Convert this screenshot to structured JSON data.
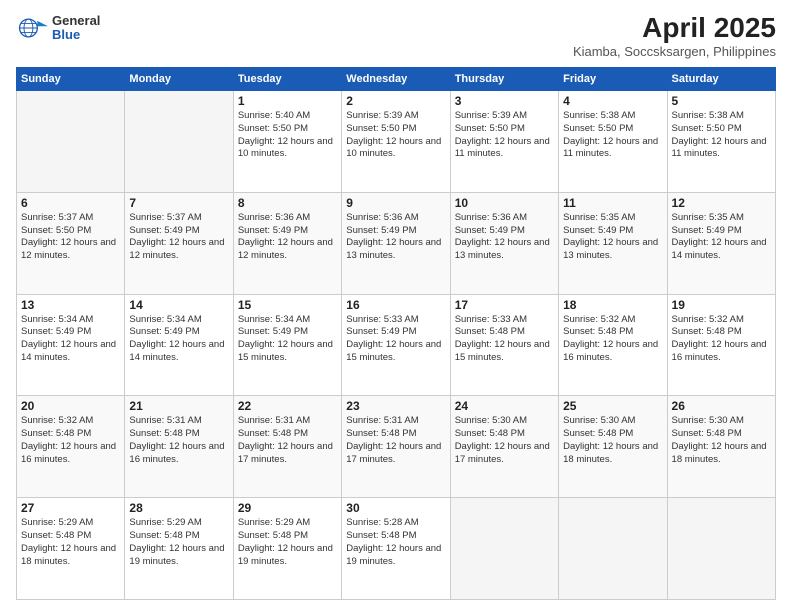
{
  "header": {
    "logo": {
      "general": "General",
      "blue": "Blue"
    },
    "title": "April 2025",
    "location": "Kiamba, Soccsksargen, Philippines"
  },
  "days_of_week": [
    "Sunday",
    "Monday",
    "Tuesday",
    "Wednesday",
    "Thursday",
    "Friday",
    "Saturday"
  ],
  "weeks": [
    {
      "stripe": "row-stripe-1",
      "days": [
        {
          "num": "",
          "info": "",
          "empty": true
        },
        {
          "num": "",
          "info": "",
          "empty": true
        },
        {
          "num": "1",
          "info": "Sunrise: 5:40 AM\nSunset: 5:50 PM\nDaylight: 12 hours and 10 minutes.",
          "empty": false
        },
        {
          "num": "2",
          "info": "Sunrise: 5:39 AM\nSunset: 5:50 PM\nDaylight: 12 hours and 10 minutes.",
          "empty": false
        },
        {
          "num": "3",
          "info": "Sunrise: 5:39 AM\nSunset: 5:50 PM\nDaylight: 12 hours and 11 minutes.",
          "empty": false
        },
        {
          "num": "4",
          "info": "Sunrise: 5:38 AM\nSunset: 5:50 PM\nDaylight: 12 hours and 11 minutes.",
          "empty": false
        },
        {
          "num": "5",
          "info": "Sunrise: 5:38 AM\nSunset: 5:50 PM\nDaylight: 12 hours and 11 minutes.",
          "empty": false
        }
      ]
    },
    {
      "stripe": "row-stripe-2",
      "days": [
        {
          "num": "6",
          "info": "Sunrise: 5:37 AM\nSunset: 5:50 PM\nDaylight: 12 hours and 12 minutes.",
          "empty": false
        },
        {
          "num": "7",
          "info": "Sunrise: 5:37 AM\nSunset: 5:49 PM\nDaylight: 12 hours and 12 minutes.",
          "empty": false
        },
        {
          "num": "8",
          "info": "Sunrise: 5:36 AM\nSunset: 5:49 PM\nDaylight: 12 hours and 12 minutes.",
          "empty": false
        },
        {
          "num": "9",
          "info": "Sunrise: 5:36 AM\nSunset: 5:49 PM\nDaylight: 12 hours and 13 minutes.",
          "empty": false
        },
        {
          "num": "10",
          "info": "Sunrise: 5:36 AM\nSunset: 5:49 PM\nDaylight: 12 hours and 13 minutes.",
          "empty": false
        },
        {
          "num": "11",
          "info": "Sunrise: 5:35 AM\nSunset: 5:49 PM\nDaylight: 12 hours and 13 minutes.",
          "empty": false
        },
        {
          "num": "12",
          "info": "Sunrise: 5:35 AM\nSunset: 5:49 PM\nDaylight: 12 hours and 14 minutes.",
          "empty": false
        }
      ]
    },
    {
      "stripe": "row-stripe-3",
      "days": [
        {
          "num": "13",
          "info": "Sunrise: 5:34 AM\nSunset: 5:49 PM\nDaylight: 12 hours and 14 minutes.",
          "empty": false
        },
        {
          "num": "14",
          "info": "Sunrise: 5:34 AM\nSunset: 5:49 PM\nDaylight: 12 hours and 14 minutes.",
          "empty": false
        },
        {
          "num": "15",
          "info": "Sunrise: 5:34 AM\nSunset: 5:49 PM\nDaylight: 12 hours and 15 minutes.",
          "empty": false
        },
        {
          "num": "16",
          "info": "Sunrise: 5:33 AM\nSunset: 5:49 PM\nDaylight: 12 hours and 15 minutes.",
          "empty": false
        },
        {
          "num": "17",
          "info": "Sunrise: 5:33 AM\nSunset: 5:48 PM\nDaylight: 12 hours and 15 minutes.",
          "empty": false
        },
        {
          "num": "18",
          "info": "Sunrise: 5:32 AM\nSunset: 5:48 PM\nDaylight: 12 hours and 16 minutes.",
          "empty": false
        },
        {
          "num": "19",
          "info": "Sunrise: 5:32 AM\nSunset: 5:48 PM\nDaylight: 12 hours and 16 minutes.",
          "empty": false
        }
      ]
    },
    {
      "stripe": "row-stripe-4",
      "days": [
        {
          "num": "20",
          "info": "Sunrise: 5:32 AM\nSunset: 5:48 PM\nDaylight: 12 hours and 16 minutes.",
          "empty": false
        },
        {
          "num": "21",
          "info": "Sunrise: 5:31 AM\nSunset: 5:48 PM\nDaylight: 12 hours and 16 minutes.",
          "empty": false
        },
        {
          "num": "22",
          "info": "Sunrise: 5:31 AM\nSunset: 5:48 PM\nDaylight: 12 hours and 17 minutes.",
          "empty": false
        },
        {
          "num": "23",
          "info": "Sunrise: 5:31 AM\nSunset: 5:48 PM\nDaylight: 12 hours and 17 minutes.",
          "empty": false
        },
        {
          "num": "24",
          "info": "Sunrise: 5:30 AM\nSunset: 5:48 PM\nDaylight: 12 hours and 17 minutes.",
          "empty": false
        },
        {
          "num": "25",
          "info": "Sunrise: 5:30 AM\nSunset: 5:48 PM\nDaylight: 12 hours and 18 minutes.",
          "empty": false
        },
        {
          "num": "26",
          "info": "Sunrise: 5:30 AM\nSunset: 5:48 PM\nDaylight: 12 hours and 18 minutes.",
          "empty": false
        }
      ]
    },
    {
      "stripe": "row-stripe-5",
      "days": [
        {
          "num": "27",
          "info": "Sunrise: 5:29 AM\nSunset: 5:48 PM\nDaylight: 12 hours and 18 minutes.",
          "empty": false
        },
        {
          "num": "28",
          "info": "Sunrise: 5:29 AM\nSunset: 5:48 PM\nDaylight: 12 hours and 19 minutes.",
          "empty": false
        },
        {
          "num": "29",
          "info": "Sunrise: 5:29 AM\nSunset: 5:48 PM\nDaylight: 12 hours and 19 minutes.",
          "empty": false
        },
        {
          "num": "30",
          "info": "Sunrise: 5:28 AM\nSunset: 5:48 PM\nDaylight: 12 hours and 19 minutes.",
          "empty": false
        },
        {
          "num": "",
          "info": "",
          "empty": true
        },
        {
          "num": "",
          "info": "",
          "empty": true
        },
        {
          "num": "",
          "info": "",
          "empty": true
        }
      ]
    }
  ]
}
